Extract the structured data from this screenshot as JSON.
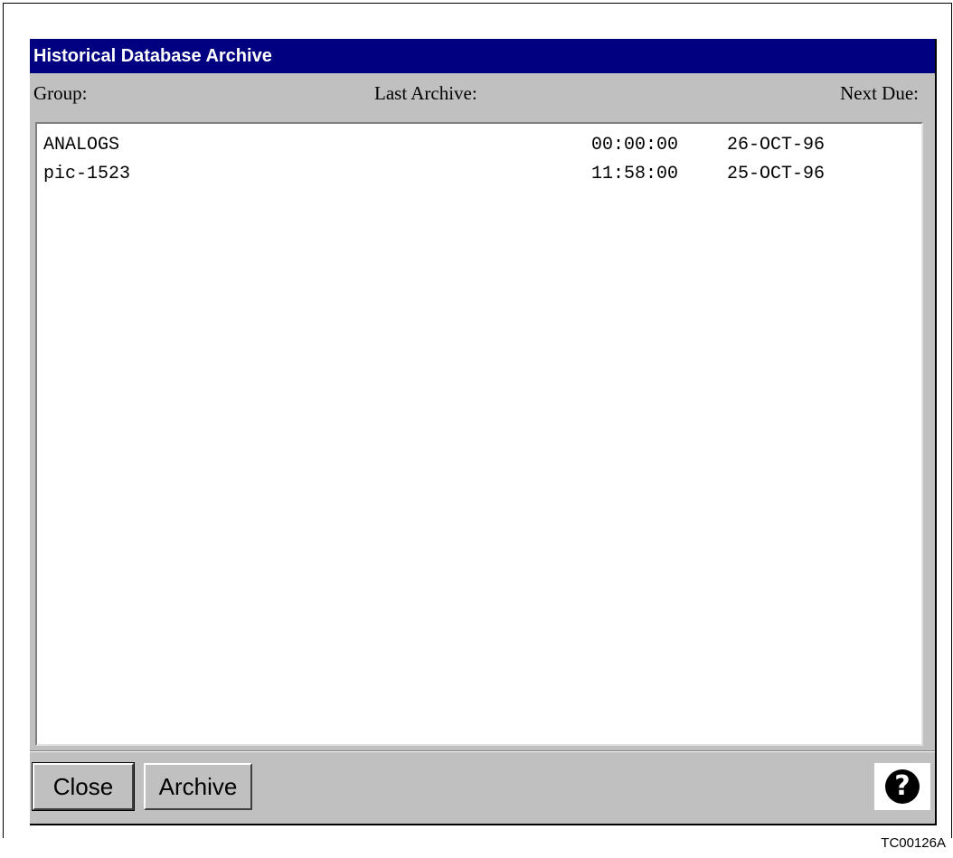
{
  "window": {
    "title": "Historical Database Archive"
  },
  "columns": {
    "group": "Group:",
    "last_archive": "Last Archive:",
    "next_due": "Next Due:"
  },
  "rows": [
    {
      "group": "ANALOGS",
      "time": "00:00:00",
      "date": "26-OCT-96"
    },
    {
      "group": "pic-1523",
      "time": "11:58:00",
      "date": "25-OCT-96"
    }
  ],
  "buttons": {
    "close": "Close",
    "archive": "Archive",
    "help_icon": "help-icon"
  },
  "figure_id": "TC00126A",
  "colors": {
    "titlebar": "#000080",
    "window_bg": "#c0c0c0",
    "list_bg": "#ffffff"
  }
}
